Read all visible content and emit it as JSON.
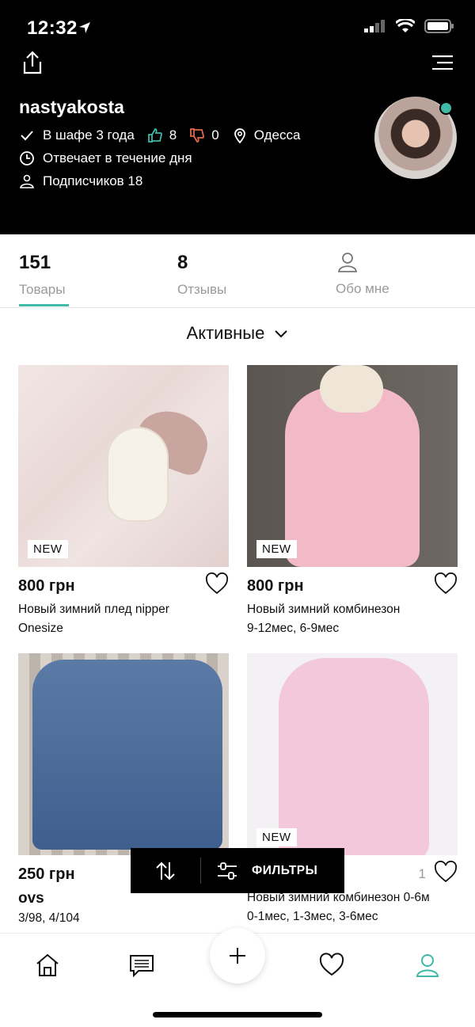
{
  "status_bar": {
    "time": "12:32"
  },
  "profile": {
    "username": "nastyakosta",
    "in_wardrobe": "В шафе 3 года",
    "likes": "8",
    "dislikes": "0",
    "city": "Одесса",
    "response": "Отвечает в течение дня",
    "followers": "Подписчиков 18"
  },
  "tabs": [
    {
      "count": "151",
      "label": "Товары"
    },
    {
      "count": "8",
      "label": "Отзывы"
    },
    {
      "label": "Обо мне"
    }
  ],
  "filter": {
    "title": "Активные"
  },
  "products": [
    {
      "badge": "NEW",
      "price": "800 грн",
      "title1": "Новый зимний плед nipper",
      "title2": "Onesize"
    },
    {
      "badge": "NEW",
      "price": "800 грн",
      "title1": "Новый зимний комбинезон",
      "title2": "9-12мес, 6-9мес"
    },
    {
      "price": "250 грн",
      "brand": "ovs",
      "sizes": "3/98, 4/104"
    },
    {
      "badge": "NEW",
      "likes": "1",
      "title1": "Новый зимний комбинезон 0-6м",
      "title2": "0-1мес, 1-3мес, 3-6мес"
    }
  ],
  "filterbar": {
    "filters_label": "ФИЛЬТРЫ"
  },
  "colors": {
    "accent": "#3fb9a8",
    "header_bg": "#000000",
    "like": "#3fb9a8",
    "dislike": "#e06a4a"
  },
  "icons": [
    "share-icon",
    "menu-icon",
    "check-icon",
    "thumbs-up-icon",
    "thumbs-down-icon",
    "location-pin-icon",
    "clock-icon",
    "followers-icon",
    "person-icon",
    "chevron-down-icon",
    "heart-icon",
    "sort-icon",
    "filter-icon",
    "home-icon",
    "messages-icon",
    "plus-icon",
    "profile-icon"
  ]
}
